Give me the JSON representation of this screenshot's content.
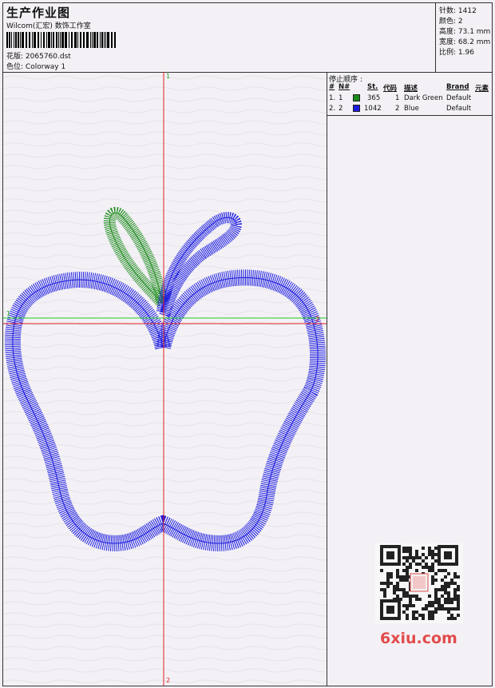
{
  "header": {
    "title": "生产作业图",
    "subtitle": "Wilcom(汇宏) 数饰工作室",
    "design_file_label": "花版:",
    "design_file": "2065760.dst",
    "colorway_label": "色位:",
    "colorway": "Colorway 1"
  },
  "specs": {
    "stitches": "针数: 1412",
    "colors": "颜色: 2",
    "height": "高度: 73.1 mm",
    "width": "宽度: 68.2 mm",
    "scale": "比例: 1.96"
  },
  "stop_sequence": {
    "title": "停止顺序 :",
    "headers": [
      "#",
      "N#",
      "St.",
      "代码",
      "描述",
      "Brand",
      "元素"
    ],
    "rows": [
      {
        "index": "1.",
        "n": "1",
        "color": "#1a8a1a",
        "stitches": "365",
        "code": "1",
        "description": "Dark Green",
        "brand": "Default"
      },
      {
        "index": "2.",
        "n": "2",
        "color": "#1a1ae0",
        "stitches": "1042",
        "code": "2",
        "description": "Blue",
        "brand": "Default"
      }
    ]
  },
  "axes": {
    "vertical_top": "1",
    "vertical_bottom": "2",
    "horizontal_left": "1",
    "horizontal_right": "2"
  },
  "colors": {
    "leaf": "#1a8a1a",
    "apple": "#1a1ae0",
    "axis_red": "#e02020",
    "axis_green": "#22cc22"
  },
  "watermark": "6xiu.com"
}
